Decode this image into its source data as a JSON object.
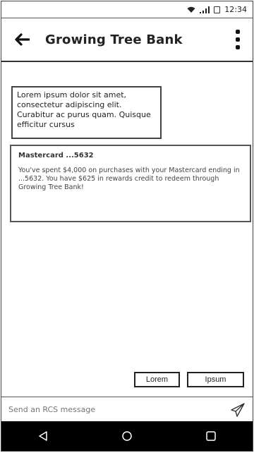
{
  "status_bar": {
    "time": "12:34"
  },
  "app_bar": {
    "title": "Growing Tree Bank"
  },
  "messages": {
    "bubble_text": "Lorem ipsum dolor sit amet, consectetur adipiscing elit. Curabitur ac purus quam. Quisque efficitur cursus",
    "card": {
      "title": "Mastercard ...5632",
      "body": "You've spent $4,000 on purchases with your Mastercard ending in ...5632. You have $625 in rewards credit to redeem through Growing Tree Bank!"
    }
  },
  "suggestions": [
    "Lorem",
    "Ipsum"
  ],
  "compose": {
    "placeholder": "Send an RCS message"
  },
  "icons": [
    "wifi-icon",
    "signal-icon",
    "battery-icon",
    "back-arrow-icon",
    "more-vert-icon",
    "send-icon",
    "nav-back-icon",
    "nav-home-icon",
    "nav-recents-icon"
  ]
}
